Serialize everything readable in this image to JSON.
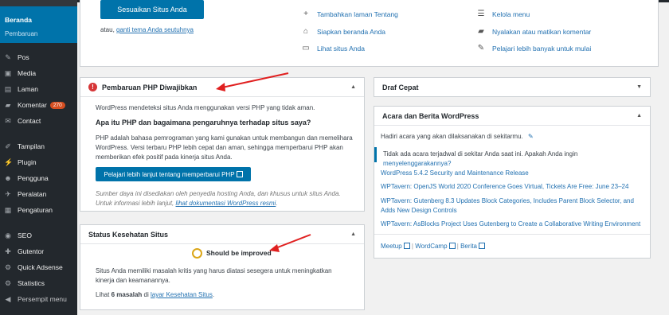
{
  "sidebar": {
    "home_title": "Beranda",
    "home_sub": "Pembaruan",
    "items": [
      {
        "label": "Pos",
        "icon": "pin-icon"
      },
      {
        "label": "Media",
        "icon": "media-icon"
      },
      {
        "label": "Laman",
        "icon": "page-icon"
      },
      {
        "label": "Komentar",
        "icon": "comment-icon",
        "badge": "270"
      },
      {
        "label": "Contact",
        "icon": "mail-icon"
      },
      {
        "label": "Tampilan",
        "icon": "brush-icon"
      },
      {
        "label": "Plugin",
        "icon": "plugin-icon"
      },
      {
        "label": "Pengguna",
        "icon": "users-icon"
      },
      {
        "label": "Peralatan",
        "icon": "tools-icon"
      },
      {
        "label": "Pengaturan",
        "icon": "settings-icon"
      },
      {
        "label": "SEO",
        "icon": "seo-icon"
      },
      {
        "label": "Gutentor",
        "icon": "gutentor-icon"
      },
      {
        "label": "Quick Adsense",
        "icon": "adsense-icon"
      },
      {
        "label": "Statistics",
        "icon": "stats-icon"
      },
      {
        "label": "Persempit menu",
        "icon": "collapse-icon"
      }
    ]
  },
  "welcome": {
    "customize_button": "Sesuaikan Situs Anda",
    "or_text": "atau,",
    "change_theme_link": "ganti tema Anda seutuhnya",
    "col2": [
      {
        "label": "Tambahkan laman Tentang",
        "icon": "plus-icon"
      },
      {
        "label": "Siapkan beranda Anda",
        "icon": "home-icon"
      },
      {
        "label": "Lihat situs Anda",
        "icon": "view-icon"
      }
    ],
    "col3": [
      {
        "label": "Kelola menu",
        "icon": "menu-icon"
      },
      {
        "label": "Nyalakan atau matikan komentar",
        "icon": "comment-icon"
      },
      {
        "label": "Pelajari lebih banyak untuk mulai",
        "icon": "learn-icon"
      }
    ]
  },
  "php_box": {
    "title": "Pembaruan PHP Diwajibkan",
    "detected": "WordPress mendeteksi situs Anda menggunakan versi PHP yang tidak aman.",
    "subheading": "Apa itu PHP dan bagaimana pengaruhnya terhadap situs saya?",
    "paragraph": "PHP adalah bahasa pemrograman yang kami gunakan untuk membangun dan memelihara WordPress. Versi terbaru PHP lebih cepat dan aman, sehingga memperbarui PHP akan memberikan efek positif pada kinerja situs Anda.",
    "button": "Pelajari lebih lanjut tentang memperbarui PHP",
    "note": "Sumber daya ini disediakan oleh penyedia hosting Anda, dan khusus untuk situs Anda. Untuk informasi lebih lanjut,",
    "note_link": "lihat dokumentasi WordPress resmi",
    "note_end": "."
  },
  "health_box": {
    "title": "Status Kesehatan Situs",
    "status": "Should be improved",
    "desc": "Situs Anda memiliki masalah kritis yang harus diatasi sesegera untuk meningkatkan kinerja dan keamanannya.",
    "see_prefix": "Lihat",
    "see_count": "6 masalah",
    "see_mid": "di",
    "see_link": "layar Kesehatan Situs",
    "see_end": "."
  },
  "draft_box": {
    "title": "Draf Cepat"
  },
  "events_box": {
    "title": "Acara dan Berita WordPress",
    "location_text": "Hadiri acara yang akan dilaksanakan di sekitarmu.",
    "no_events": "Tidak ada acara terjadwal di sekitar Anda saat ini. Apakah Anda ingin",
    "no_events_link": "menyelenggarakannya?",
    "news": [
      "WordPress 5.4.2 Security and Maintenance Release",
      "WPTavern: OpenJS World 2020 Conference Goes Virtual, Tickets Are Free: June 23–24",
      "WPTavern: Gutenberg 8.3 Updates Block Categories, Includes Parent Block Selector, and Adds New Design Controls",
      "WPTavern: AsBlocks Project Uses Gutenberg to Create a Collaborative Writing Environment"
    ],
    "footer": [
      "Meetup",
      "WordCamp",
      "Berita"
    ]
  },
  "colors": {
    "accent": "#0073aa",
    "sidebar": "#23282d",
    "error": "#d63638",
    "warning": "#dba617",
    "annotation": "#e02020"
  }
}
